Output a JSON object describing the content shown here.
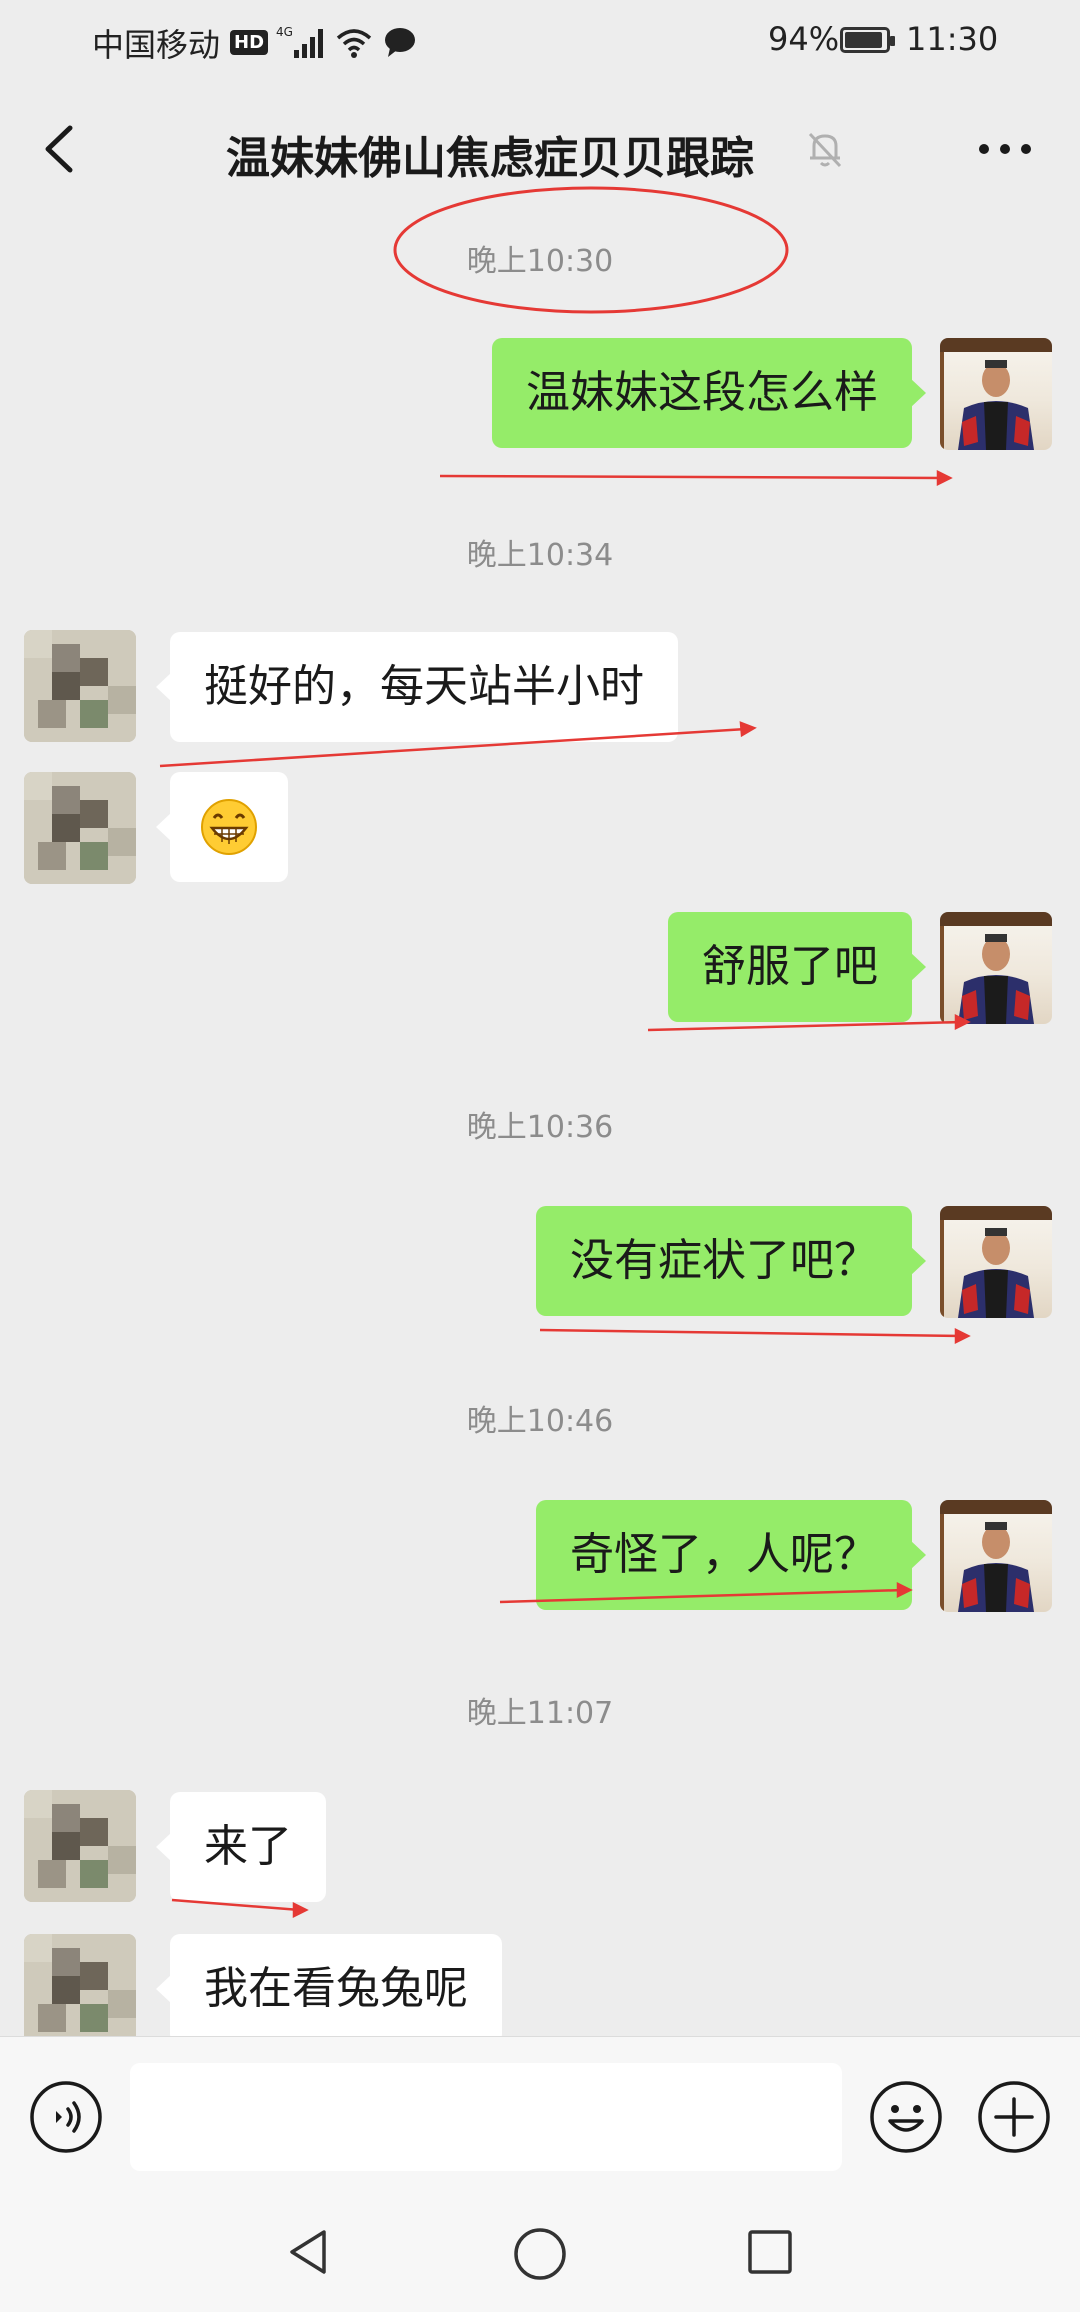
{
  "status_bar": {
    "carrier": "中国移动",
    "hd": "HD",
    "network": "4G",
    "battery": "94%",
    "battery_level": 0.94,
    "time": "11:30"
  },
  "header": {
    "title": "温妹妹佛山焦虑症贝贝跟踪",
    "icons": [
      "back-icon",
      "mute-bell-icon",
      "more-icon"
    ]
  },
  "messages": [
    {
      "type": "time",
      "text": "晚上10:30"
    },
    {
      "type": "sent",
      "text": "温妹妹这段怎么样"
    },
    {
      "type": "time",
      "text": "晚上10:34"
    },
    {
      "type": "received",
      "text": "挺好的，每天站半小时"
    },
    {
      "type": "received",
      "emoji": "grinning-face-emoji"
    },
    {
      "type": "sent",
      "text": "舒服了吧"
    },
    {
      "type": "time",
      "text": "晚上10:36"
    },
    {
      "type": "sent",
      "text": "没有症状了吧？"
    },
    {
      "type": "time",
      "text": "晚上10:46"
    },
    {
      "type": "sent",
      "text": "奇怪了，人呢？"
    },
    {
      "type": "time",
      "text": "晚上11:07"
    },
    {
      "type": "received",
      "text": "来了"
    },
    {
      "type": "received",
      "text": "我在看兔兔呢"
    }
  ],
  "input_bar": {
    "value": "",
    "icons": [
      "voice-icon",
      "emoji-icon",
      "plus-icon"
    ]
  },
  "annotation_color": "#e53935",
  "bubble_colors": {
    "sent": "#95ec69",
    "received": "#ffffff"
  },
  "nav_icons": [
    "back-triangle-icon",
    "home-circle-icon",
    "recents-square-icon"
  ]
}
